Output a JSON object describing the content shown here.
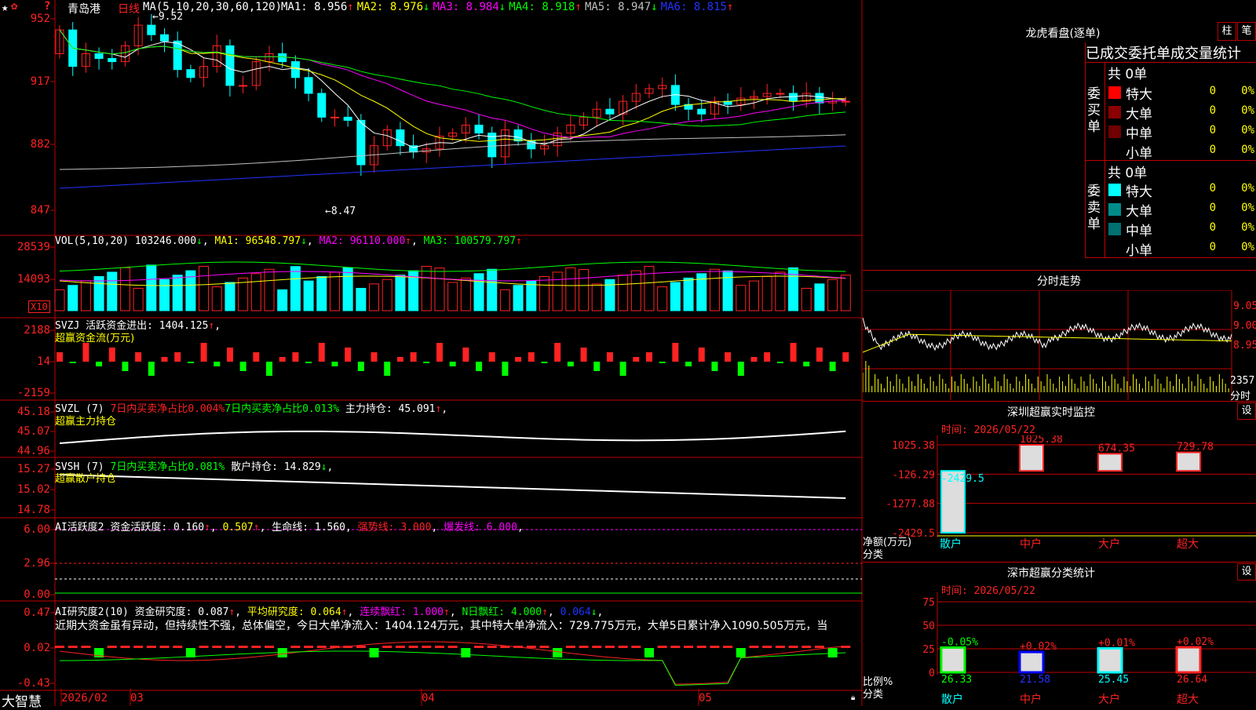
{
  "colors": {
    "up": "#ff2222",
    "down": "#00ffff",
    "frame": "#c00000",
    "yellow": "#ffff00",
    "green": "#00ff00",
    "magenta": "#ff00ff",
    "blue": "#2233ff",
    "white": "#ffffff",
    "red": "#ff2222"
  },
  "header": {
    "icons": [
      "star-icon",
      "settings-icon"
    ],
    "stock": "青岛港",
    "period": "日线",
    "ma_label": "MA(5,10,20,30,60,120)",
    "ma": [
      {
        "label": "MA1: 8.956",
        "arrow": "↑",
        "color": "#ffffff"
      },
      {
        "label": "MA2: 8.976",
        "arrow": "↓",
        "color": "#ffff00"
      },
      {
        "label": "MA3: 8.984",
        "arrow": "↓",
        "color": "#ff00ff"
      },
      {
        "label": "MA4: 8.918",
        "arrow": "↑",
        "color": "#00ff00"
      },
      {
        "label": "MA5: 8.947",
        "arrow": "↓",
        "color": "#c0c0c0"
      },
      {
        "label": "MA6: 8.815",
        "arrow": "↑",
        "color": "#2233ff"
      }
    ],
    "question": "?"
  },
  "price_panel": {
    "yticks": [
      "952",
      "917",
      "882",
      "847"
    ],
    "high_label": "9.52",
    "low_label": "8.47"
  },
  "vol_panel": {
    "title": "VOL(5,10,20)",
    "value": "103246.000",
    "v_arrow": "↓",
    "ma1": "MA1: 96548.797",
    "ma1_arrow": "↓",
    "ma2": "MA2: 96110.000",
    "ma2_arrow": "↑",
    "ma3": "MA3: 100579.797",
    "ma3_arrow": "↑",
    "yticks": [
      "28539",
      "14093"
    ],
    "unit": "X10"
  },
  "svzj_panel": {
    "title": "SVZJ",
    "label": "活跃资金进出: 1404.125",
    "arrow": "↑",
    "comma": ",",
    "subtitle": "超赢资金流(万元)",
    "yticks": [
      "2188",
      "14",
      "-2159"
    ]
  },
  "svzl_panel": {
    "title": "SVZL (7)",
    "t1": "7日内买卖净占比0.004%",
    "t2": "7日内买卖净占比0.013%",
    "t3": "主力持仓: 45.091",
    "arrow": "↑",
    "comma": ",",
    "subtitle": "超赢主力持仓",
    "yticks": [
      "45.18",
      "45.07",
      "44.96"
    ]
  },
  "svsh_panel": {
    "title": "SVSH (7)",
    "t1": "7日内买卖净占比0.081%",
    "t2": "散户持仓: 14.829",
    "arrow": "↓",
    "comma": ",",
    "subtitle": "超赢散户持仓",
    "yticks": [
      "15.27",
      "15.02",
      "14.78"
    ]
  },
  "ai_active_panel": {
    "title": "AI活跃度2",
    "t1": "资金活跃度: 0.160",
    "a1": "↑",
    "t2": "0.507",
    "a2": "↑",
    "t3": "生命线: 1.560",
    "t4": "强势线: 3.000",
    "t5": "爆发线: 6.000",
    "comma": ",",
    "yticks": [
      "6.00",
      "2.96",
      "0.00"
    ]
  },
  "ai_research_panel": {
    "title": "AI研究度2(10)",
    "t1": "资金研究度: 0.087",
    "a1": "↑",
    "t2": "平均研究度: 0.064",
    "a2": "↑",
    "t3": "连续飘红: 1.000",
    "a3": "↑",
    "t4": "N日飘红: 4.000",
    "a4": "↑",
    "t5": "0.064",
    "a5": "↓",
    "comma": ",",
    "text": "近期大资金虽有异动，但持续性不强，总体偏空，今日大单净流入：1404.124万元，其中特大单净流入：729.775万元，大单5日累计净入1090.505万元，当",
    "yticks": [
      "0.47",
      "0.02",
      "-0.43"
    ]
  },
  "footer": {
    "brand": "大智慧",
    "dates": [
      "2026/02",
      "03",
      "04",
      "05"
    ],
    "lock_icon": "lock-icon"
  },
  "dragon": {
    "title": "龙虎看盘(逐单)",
    "btn1": "柱",
    "btn2": "笔",
    "subtitle": "已成交委托单成交量统计",
    "buy": {
      "side_label": "委买单",
      "total": "共 0单",
      "rows": [
        {
          "name": "特大",
          "count": "0",
          "pct": "0%",
          "color": "#ff0000"
        },
        {
          "name": "大单",
          "count": "0",
          "pct": "0%",
          "color": "#8b0000"
        },
        {
          "name": "中单",
          "count": "0",
          "pct": "0%",
          "color": "#700000"
        },
        {
          "name": "小单",
          "count": "0",
          "pct": "0%",
          "color": "#000000"
        }
      ]
    },
    "sell": {
      "side_label": "委卖单",
      "total": "共 0单",
      "rows": [
        {
          "name": "特大",
          "count": "0",
          "pct": "0%",
          "color": "#00ffff"
        },
        {
          "name": "大单",
          "count": "0",
          "pct": "0%",
          "color": "#008b8b"
        },
        {
          "name": "中单",
          "count": "0",
          "pct": "0%",
          "color": "#007070"
        },
        {
          "name": "小单",
          "count": "0",
          "pct": "0%",
          "color": "#000000"
        }
      ]
    }
  },
  "intraday": {
    "title": "分时走势",
    "yticks": [
      "9.05",
      "9.00",
      "8.95"
    ],
    "vol": "2357",
    "unit": "分时"
  },
  "realtime": {
    "title": "深圳超赢实时监控",
    "btn": "设",
    "time": "时间: 2026/05/22",
    "ylabel": "净额(万元)",
    "xlabel": "分类",
    "yticks": [
      "1025.38",
      "-126.29",
      "-1277.88",
      "-2429.5"
    ],
    "chart_data": {
      "type": "bar",
      "categories": [
        "散户",
        "中户",
        "大户",
        "超大"
      ],
      "values": [
        -2429.5,
        1025.38,
        674.35,
        729.78
      ],
      "value_labels": [
        "-2429.5",
        "1025.38",
        "674.35",
        "729.78"
      ],
      "ylim": [
        -2429.5,
        1025.38
      ],
      "xlabel": "分类",
      "ylabel": "净额(万元)"
    }
  },
  "category": {
    "title": "深市超赢分类统计",
    "btn": "设",
    "time": "时间: 2026/05/22",
    "ylabel": "比例%",
    "xlabel": "分类",
    "yticks": [
      "75",
      "50",
      "25",
      "0"
    ],
    "chart_data": {
      "type": "bar",
      "categories": [
        "散户",
        "中户",
        "大户",
        "超大"
      ],
      "values": [
        26.33,
        21.58,
        25.45,
        26.64
      ],
      "changes": [
        "-0.05%",
        "+0.02%",
        "+0.01%",
        "+0.02%"
      ],
      "ylim": [
        0,
        75
      ],
      "xlabel": "分类",
      "ylabel": "比例%"
    }
  }
}
